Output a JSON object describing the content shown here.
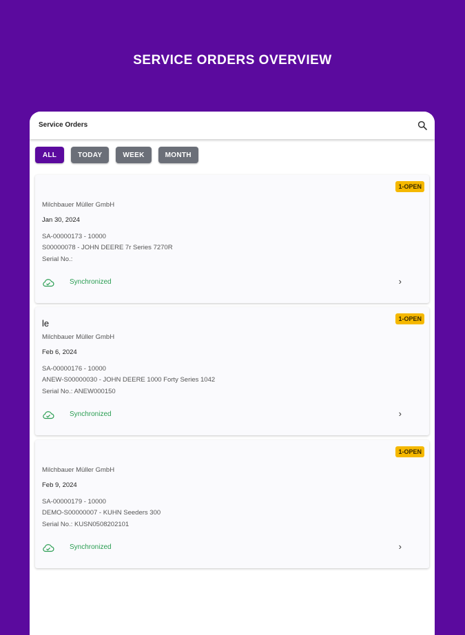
{
  "hero": {
    "title": "SERVICE ORDERS OVERVIEW"
  },
  "appbar": {
    "title": "Service Orders",
    "search_icon": "search-icon"
  },
  "filters": [
    {
      "label": "ALL",
      "active": true
    },
    {
      "label": "TODAY",
      "active": false
    },
    {
      "label": "WEEK",
      "active": false
    },
    {
      "label": "MONTH",
      "active": false
    }
  ],
  "colors": {
    "brand": "#5b0a9e",
    "badge": "#f5b800",
    "sync": "#2a9d52",
    "chip": "#6b6f78"
  },
  "orders": [
    {
      "name": "",
      "status": "1-OPEN",
      "customer": "Milchbauer Müller GmbH",
      "date": "Jan 30, 2024",
      "order": "SA-00000173 - 10000",
      "equipment": "S00000078 - JOHN DEERE 7r Series 7270R",
      "serial": "Serial No.:",
      "sync": "Synchronized",
      "sync_icon": "cloud-check-icon",
      "chevron_icon": "chevron-right-icon",
      "chevron": "›"
    },
    {
      "name": "le",
      "status": "1-OPEN",
      "customer": "Milchbauer Müller GmbH",
      "date": "Feb 6, 2024",
      "order": "SA-00000176 - 10000",
      "equipment": "ANEW-S00000030 - JOHN DEERE 1000 Forty Series 1042",
      "serial": "Serial No.: ANEW000150",
      "sync": "Synchronized",
      "sync_icon": "cloud-check-icon",
      "chevron_icon": "chevron-right-icon",
      "chevron": "›"
    },
    {
      "name": "",
      "status": "1-OPEN",
      "customer": "Milchbauer Müller GmbH",
      "date": "Feb 9, 2024",
      "order": "SA-00000179 - 10000",
      "equipment": "DEMO-S00000007 - KUHN Seeders 300",
      "serial": "Serial No.: KUSN0508202101",
      "sync": "Synchronized",
      "sync_icon": "cloud-check-icon",
      "chevron_icon": "chevron-right-icon",
      "chevron": "›"
    }
  ]
}
